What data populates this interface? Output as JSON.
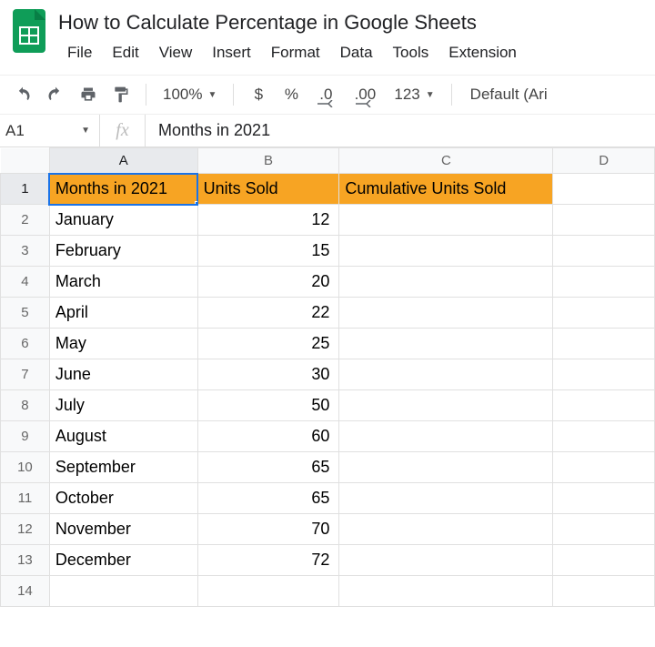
{
  "doc": {
    "title": "How to Calculate Percentage in Google Sheets"
  },
  "menu": {
    "file": "File",
    "edit": "Edit",
    "view": "View",
    "insert": "Insert",
    "format": "Format",
    "data": "Data",
    "tools": "Tools",
    "extensions": "Extension"
  },
  "toolbar": {
    "zoom": "100%",
    "currency": "$",
    "percent": "%",
    "dec_dec": ".0",
    "inc_dec": ".00",
    "more_fmt": "123",
    "font": "Default (Ari"
  },
  "name_box": "A1",
  "formula": "Months in 2021",
  "columns": [
    "A",
    "B",
    "C",
    "D"
  ],
  "selected_col_idx": 0,
  "selected_row_idx": 0,
  "header_row": {
    "a": "Months in 2021",
    "b": "Units Sold",
    "c": "Cumulative Units Sold"
  },
  "rows": [
    {
      "a": "January",
      "b": "12"
    },
    {
      "a": "February",
      "b": "15"
    },
    {
      "a": "March",
      "b": "20"
    },
    {
      "a": "April",
      "b": "22"
    },
    {
      "a": "May",
      "b": "25"
    },
    {
      "a": "June",
      "b": "30"
    },
    {
      "a": "July",
      "b": "50"
    },
    {
      "a": "August",
      "b": "60"
    },
    {
      "a": "September",
      "b": "65"
    },
    {
      "a": "October",
      "b": "65"
    },
    {
      "a": "November",
      "b": "70"
    },
    {
      "a": "December",
      "b": "72"
    }
  ],
  "blank_rows": 1
}
